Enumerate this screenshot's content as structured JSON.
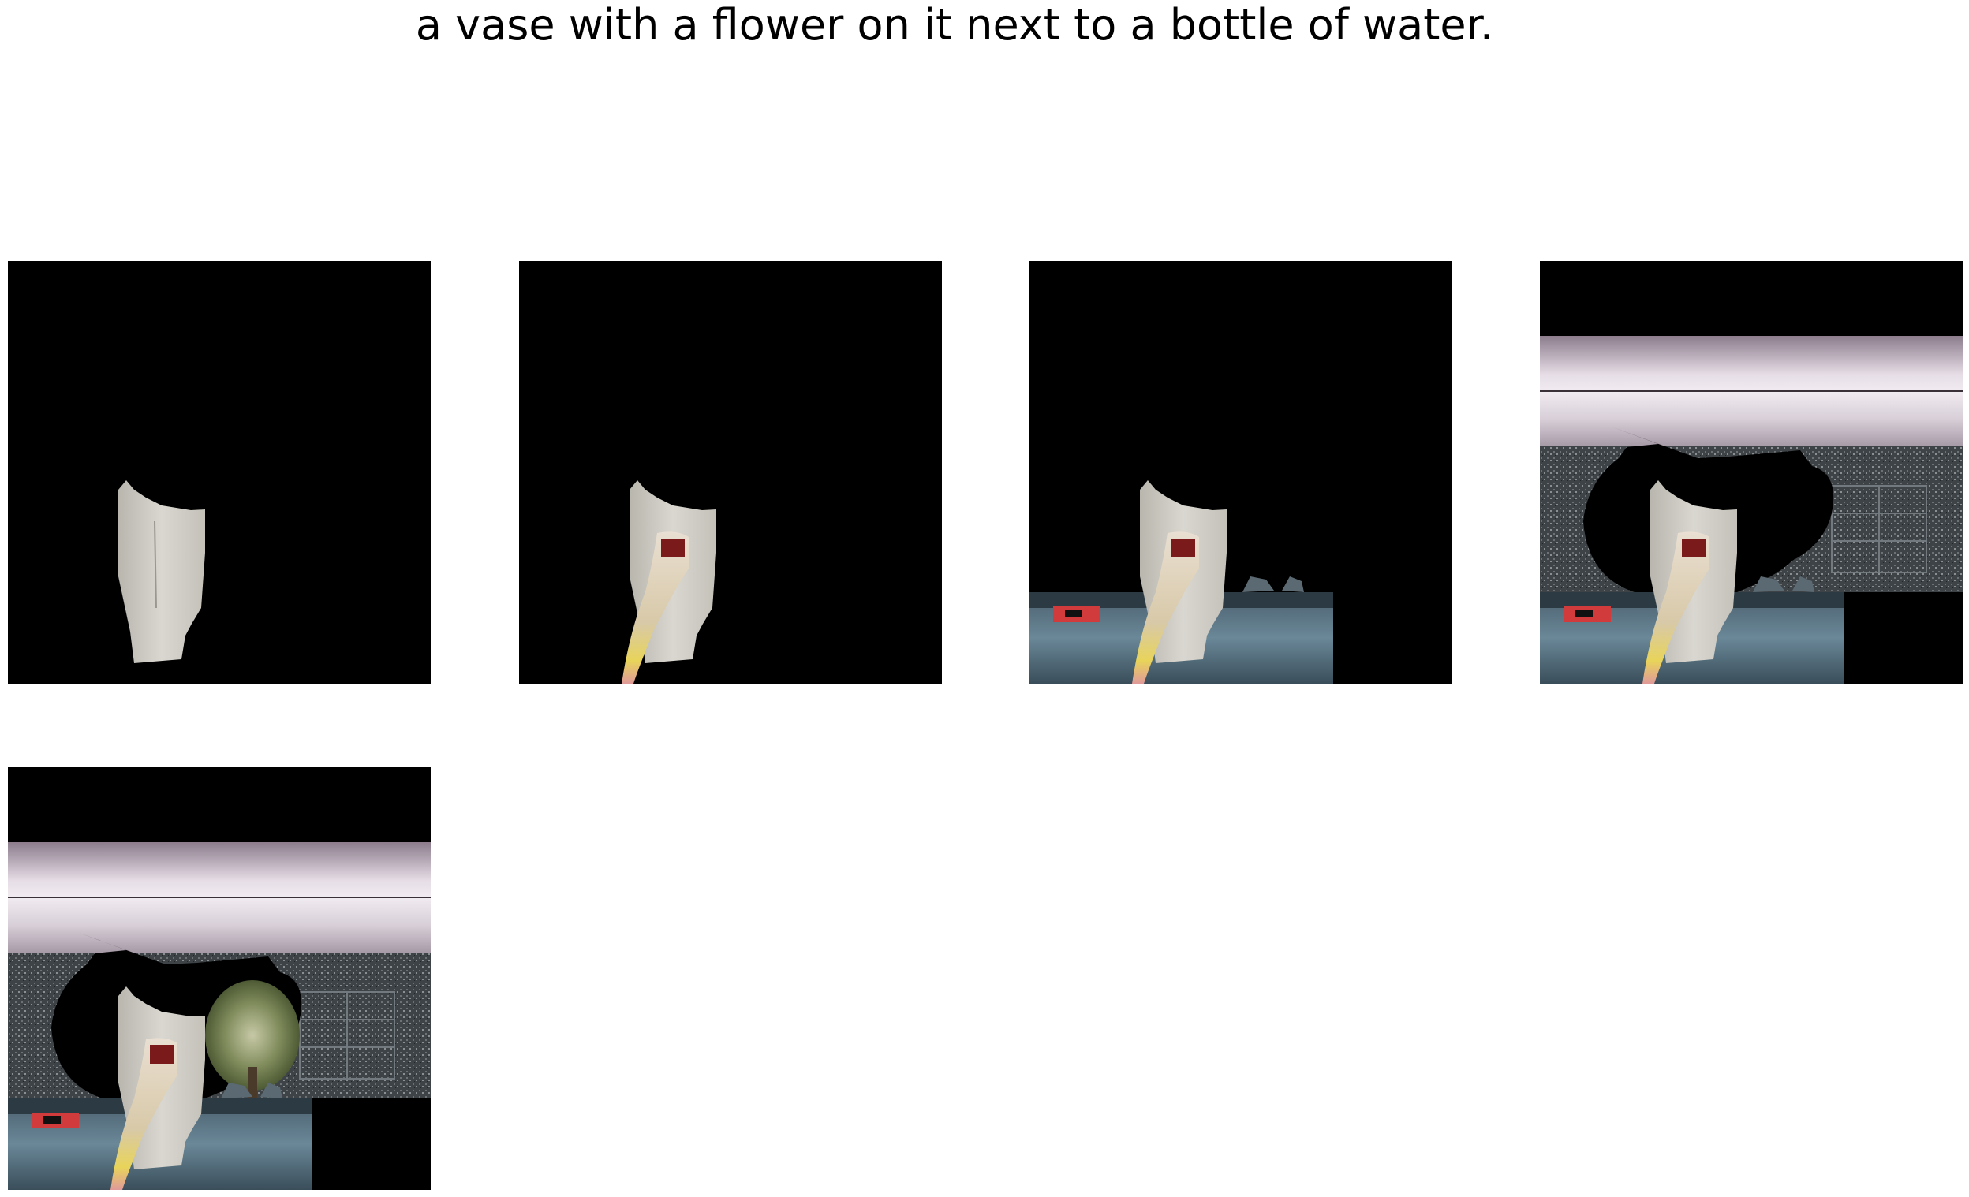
{
  "caption": "a vase with a flower on it next to a bottle of water.",
  "panels": [
    {
      "step": 1,
      "layers": [
        "vase"
      ]
    },
    {
      "step": 2,
      "layers": [
        "vase",
        "flower-stem"
      ]
    },
    {
      "step": 3,
      "layers": [
        "vase",
        "flower-stem",
        "table"
      ]
    },
    {
      "step": 4,
      "layers": [
        "vase",
        "flower-stem",
        "table",
        "wall-background",
        "bottle"
      ]
    },
    {
      "step": 5,
      "layers": [
        "vase",
        "flower-stem",
        "table",
        "wall-background",
        "bottle",
        "tree"
      ]
    }
  ]
}
